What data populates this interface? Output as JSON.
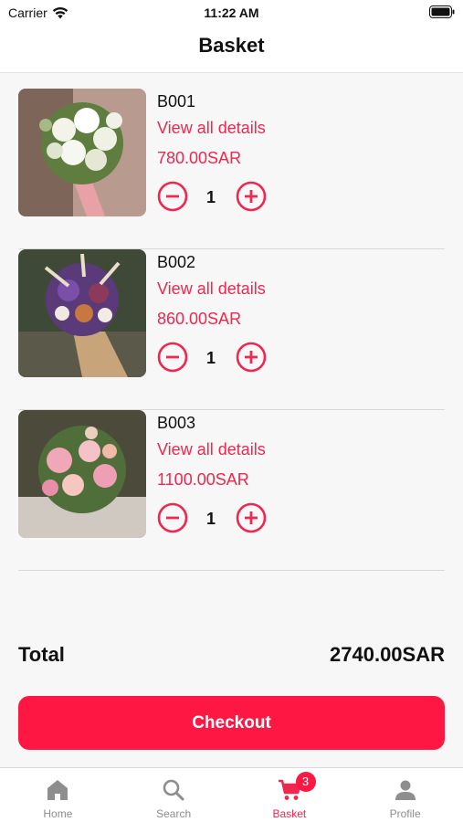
{
  "status_bar": {
    "carrier": "Carrier",
    "time": "11:22 AM"
  },
  "nav": {
    "title": "Basket"
  },
  "colors": {
    "accent": "#ff1744",
    "accent_text": "#f0274f",
    "inactive": "#8e8e8e"
  },
  "items": [
    {
      "code": "B001",
      "details_link": "View all details",
      "price": "780.00SAR",
      "quantity": "1",
      "image": "white-flower-bouquet"
    },
    {
      "code": "B002",
      "details_link": "View all details",
      "price": "860.00SAR",
      "quantity": "1",
      "image": "purple-dried-flower-bouquet"
    },
    {
      "code": "B003",
      "details_link": "View all details",
      "price": "1100.00SAR",
      "quantity": "1",
      "image": "pink-peony-bouquet"
    }
  ],
  "summary": {
    "total_label": "Total",
    "total_amount": "2740.00SAR"
  },
  "checkout": {
    "label": "Checkout"
  },
  "tabs": [
    {
      "label": "Home",
      "icon": "home-icon"
    },
    {
      "label": "Search",
      "icon": "search-icon"
    },
    {
      "label": "Basket",
      "icon": "cart-icon",
      "badge": "3",
      "active": true
    },
    {
      "label": "Profile",
      "icon": "person-icon"
    }
  ]
}
